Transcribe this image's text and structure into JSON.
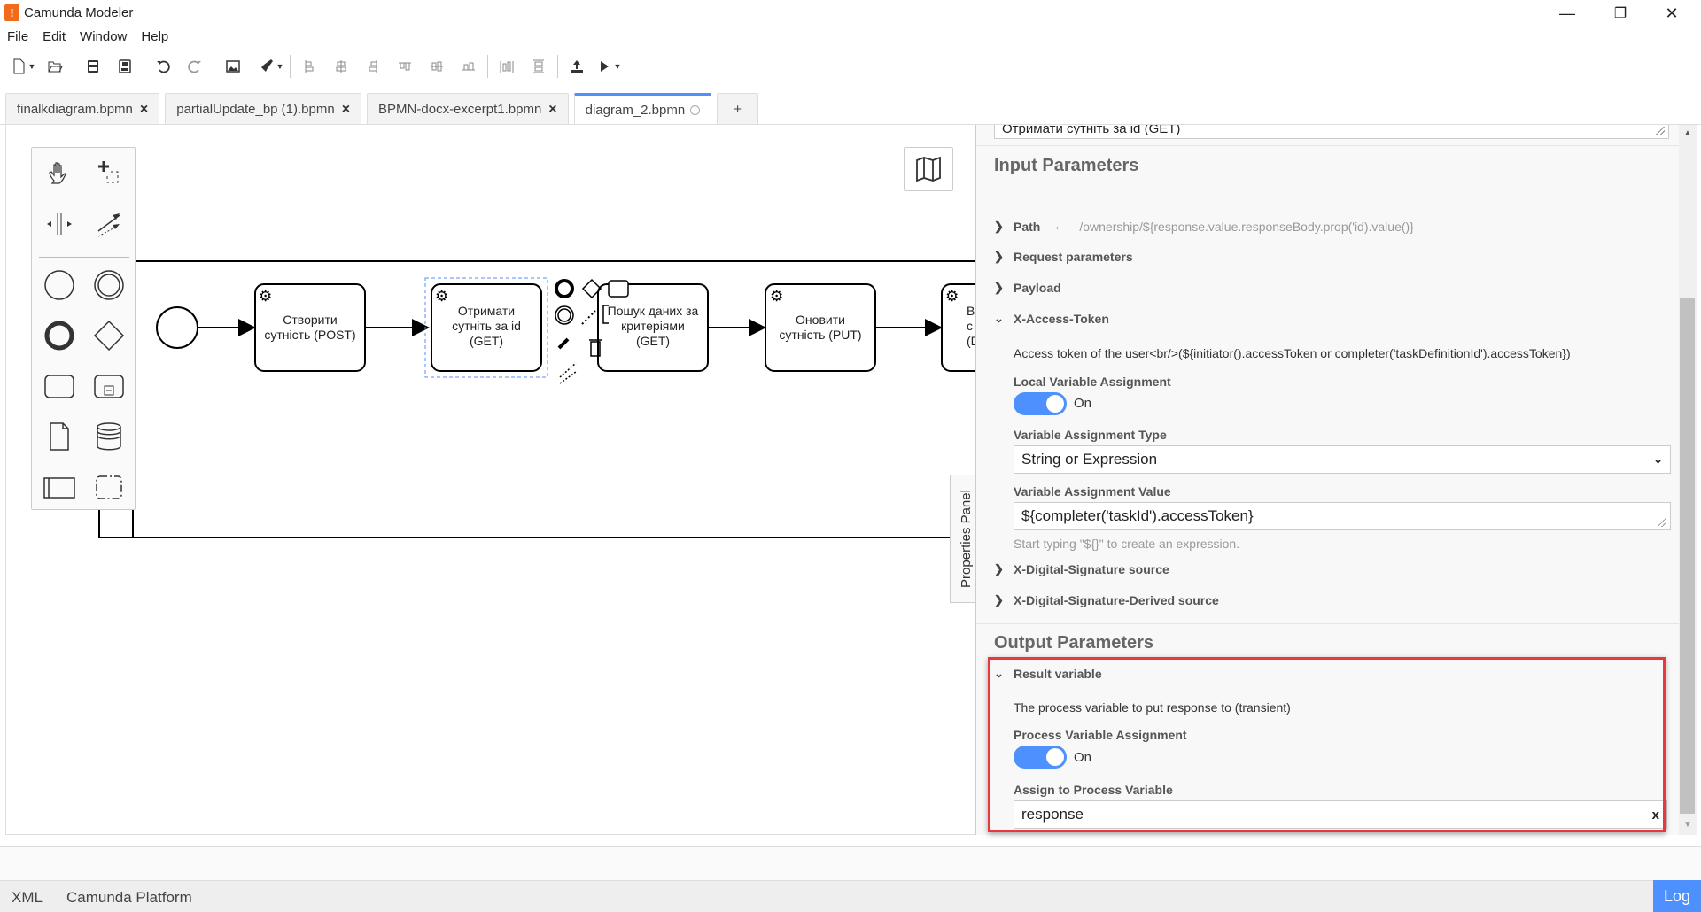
{
  "window": {
    "title": "Camunda Modeler",
    "logo_glyph": "!",
    "controls": {
      "minimize": "—",
      "maximize": "❐",
      "close": "✕"
    }
  },
  "menu": [
    "File",
    "Edit",
    "Window",
    "Help"
  ],
  "toolbar": {
    "icons": [
      "new-file-icon",
      "open-file-icon",
      "save-icon",
      "save-as-icon",
      "undo-icon",
      "redo-icon",
      "export-image-icon",
      "color-picker-icon",
      "align-left-icon",
      "align-center-icon",
      "align-right-icon",
      "align-top-icon",
      "align-middle-icon",
      "align-bottom-icon",
      "distribute-horizontal-icon",
      "distribute-vertical-icon",
      "deploy-icon",
      "run-icon"
    ]
  },
  "tabs": [
    {
      "label": "finalkdiagram.bpmn",
      "close": "×"
    },
    {
      "label": "partialUpdate_bp (1).bpmn",
      "close": "×"
    },
    {
      "label": "BPMN-docx-excerpt1.bpmn",
      "close": "×"
    },
    {
      "label": "diagram_2.bpmn",
      "active": true
    }
  ],
  "new_tab_label": "+",
  "diagram": {
    "tasks": [
      {
        "line1": "Створити",
        "line2": "сутність (POST)",
        "line3": ""
      },
      {
        "line1": "Отримати",
        "line2": "сутніть за id",
        "line3": "(GET)"
      },
      {
        "line1": "Пошук даних за",
        "line2": "критеріями",
        "line3": "(GET)"
      },
      {
        "line1": "Оновити",
        "line2": "сутність (PUT)",
        "line3": ""
      },
      {
        "line1": "В",
        "line2": "с",
        "line3": "(D"
      }
    ]
  },
  "properties_tab_label": "Properties Panel",
  "panel": {
    "name_value": "Отримати сутніть за id (GET)",
    "input_title": "Input Parameters",
    "path_label": "Path",
    "path_arrow": "←",
    "path_value": "/ownership/${response.value.responseBody.prop('id).value()}",
    "request_params_label": "Request parameters",
    "payload_label": "Payload",
    "xat_label": "X-Access-Token",
    "xat_desc": "Access token of the user<br/>(${initiator().accessToken or completer('taskDefinitionId').accessToken})",
    "local_var_label": "Local Variable Assignment",
    "local_var_toggle": "On",
    "var_type_label": "Variable Assignment Type",
    "var_type_value": "String or Expression",
    "var_value_label": "Variable Assignment Value",
    "var_value_value": "${completer('taskId').accessToken}",
    "var_value_hint": "Start typing \"${}\" to create an expression.",
    "xds_label": "X-Digital-Signature source",
    "xdsd_label": "X-Digital-Signature-Derived source",
    "output_title": "Output Parameters",
    "result_label": "Result variable",
    "result_desc": "The process variable to put response to (transient)",
    "pva_label": "Process Variable Assignment",
    "pva_toggle": "On",
    "assign_label": "Assign to Process Variable",
    "assign_value": "response",
    "clear_glyph": "x"
  },
  "status": {
    "xml": "XML",
    "platform": "Camunda Platform",
    "log": "Log"
  },
  "colors": {
    "accent": "#4d90fe",
    "highlight": "#e8383d",
    "logo": "#f26b1d"
  }
}
